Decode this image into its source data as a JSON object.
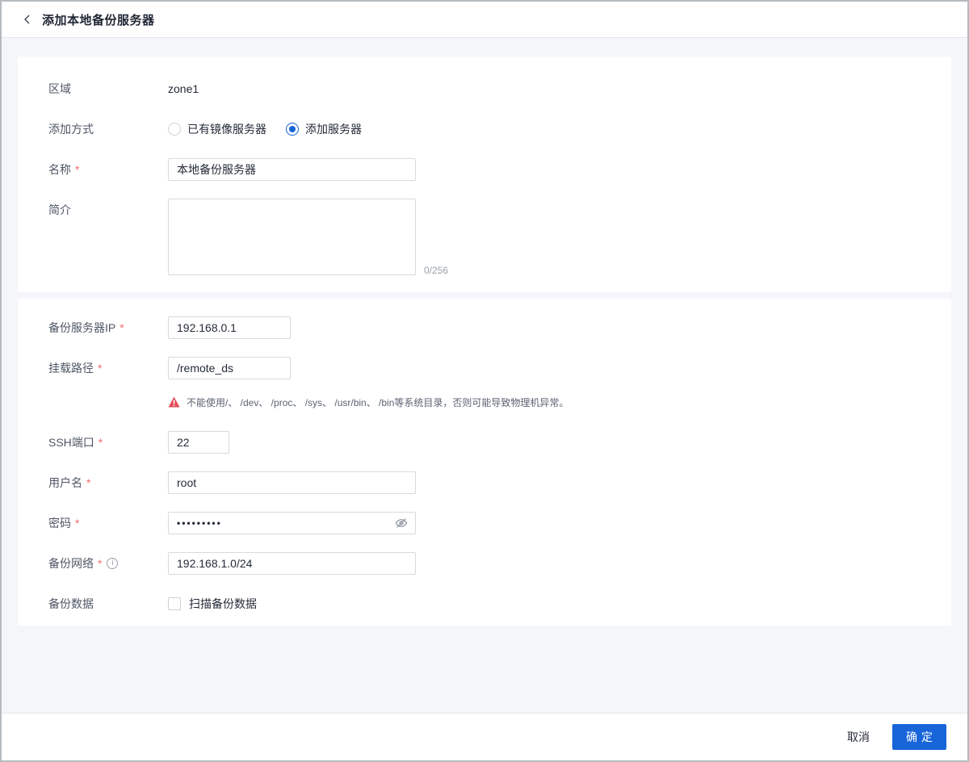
{
  "header": {
    "title": "添加本地备份服务器"
  },
  "colors": {
    "accent": "#1765d8",
    "danger": "#e34d59",
    "page_background": "#f4f6fa",
    "required_asterisk": "#f56a6a"
  },
  "form": {
    "zone": {
      "label": "区域",
      "value": "zone1"
    },
    "add_mode": {
      "label": "添加方式",
      "options": [
        {
          "label": "已有镜像服务器",
          "selected": false
        },
        {
          "label": "添加服务器",
          "selected": true
        }
      ]
    },
    "name": {
      "label": "名称",
      "required": "*",
      "value": "本地备份服务器"
    },
    "description": {
      "label": "简介",
      "value": "",
      "counter": "0/256"
    },
    "server_ip": {
      "label": "备份服务器IP",
      "required": "*",
      "value": "192.168.0.1"
    },
    "mount_path": {
      "label": "挂载路径",
      "required": "*",
      "value": "/remote_ds",
      "warning": "不能使用/、 /dev、 /proc、 /sys、 /usr/bin、 /bin等系统目录，否则可能导致物理机异常。"
    },
    "ssh_port": {
      "label": "SSH端口",
      "required": "*",
      "value": "22"
    },
    "username": {
      "label": "用户名",
      "required": "*",
      "value": "root"
    },
    "password": {
      "label": "密码",
      "required": "*",
      "value": "•••••••••"
    },
    "backup_network": {
      "label": "备份网络",
      "required": "*",
      "info_icon": "i",
      "value": "192.168.1.0/24"
    },
    "backup_data": {
      "label": "备份数据",
      "checkbox_label": "扫描备份数据",
      "checked": false
    }
  },
  "footer": {
    "cancel_label": "取消",
    "confirm_label": "确定"
  }
}
